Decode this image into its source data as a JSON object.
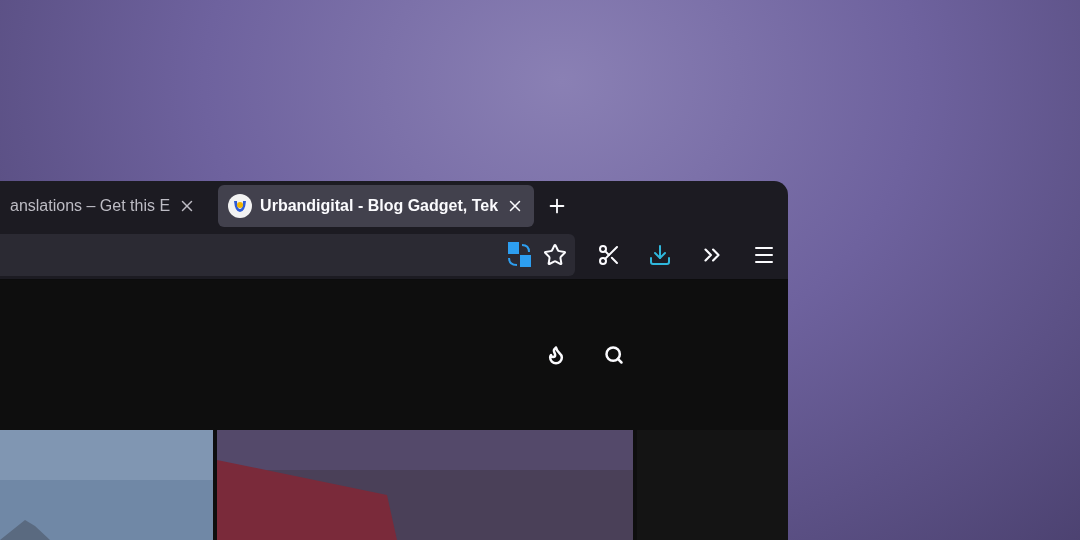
{
  "window": {
    "tabs": [
      {
        "title": "anslations – Get this E",
        "selected": false
      },
      {
        "title": "Urbandigital - Blog Gadget, Tek",
        "selected": true
      }
    ]
  },
  "page": {
    "thumbnails": [
      {
        "kind": "picture"
      },
      {
        "kind": "picture"
      },
      {
        "kind": "panel"
      }
    ]
  }
}
